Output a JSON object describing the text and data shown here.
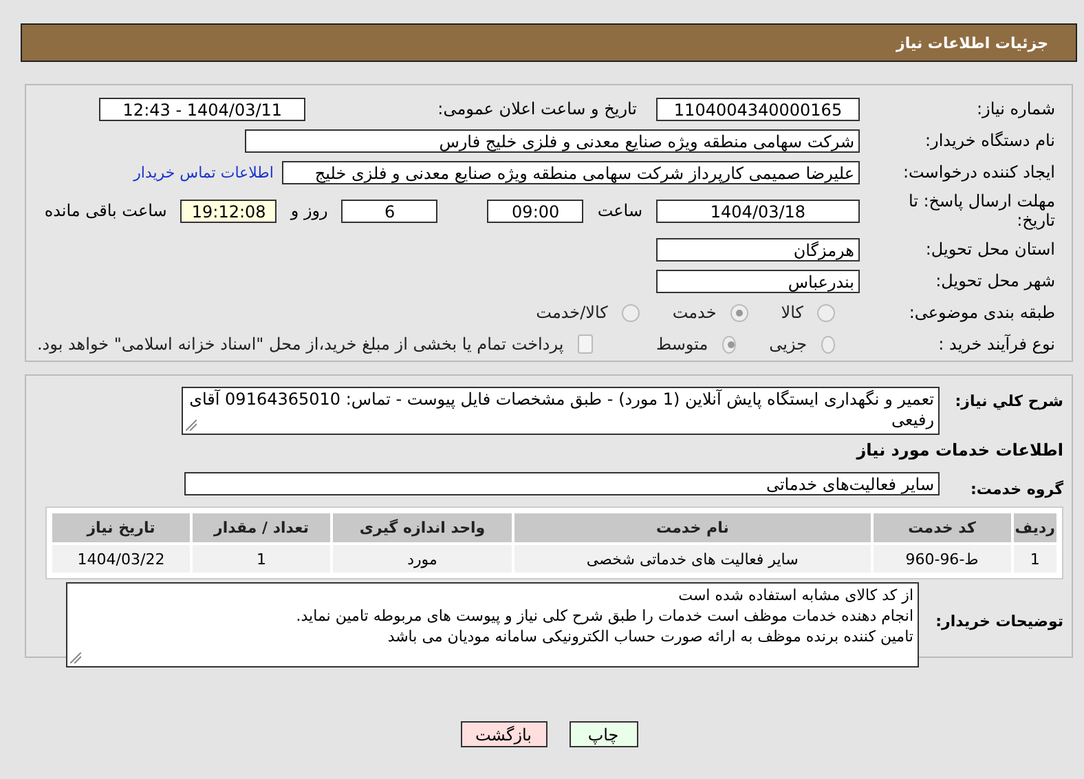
{
  "header": {
    "title": "جزئیات اطلاعات نیاز"
  },
  "details": {
    "need_number": {
      "label": "شماره نیاز:",
      "value": "1104004340000165"
    },
    "announce": {
      "label": "تاریخ و ساعت اعلان عمومی:",
      "value": "1404/03/11 - 12:43"
    },
    "buyer_org": {
      "label": "نام دستگاه خریدار:",
      "value": "شرکت سهامی منطقه ویژه صنایع معدنی و فلزی خلیج فارس"
    },
    "requester": {
      "label": "ایجاد کننده درخواست:",
      "value": "علیرضا صمیمی کارپرداز شرکت سهامی منطقه ویژه صنایع معدنی و فلزی خلیج",
      "link": "اطلاعات تماس خریدار"
    },
    "deadline": {
      "label": "مهلت ارسال پاسخ: تا تاریخ:",
      "date": "1404/03/18",
      "time_label": "ساعت",
      "time": "09:00",
      "days": "6",
      "days_label": "روز و",
      "remaining": "19:12:08",
      "remaining_label": "ساعت باقی مانده"
    },
    "province": {
      "label": "استان محل تحویل:",
      "value": "هرمزگان"
    },
    "city": {
      "label": "شهر محل تحویل:",
      "value": "بندرعباس"
    },
    "category": {
      "label": "طبقه بندی موضوعی:",
      "options": [
        {
          "label": "کالا",
          "selected": false
        },
        {
          "label": "خدمت",
          "selected": true
        },
        {
          "label": "کالا/خدمت",
          "selected": false
        }
      ]
    },
    "process": {
      "label": "نوع فرآیند خرید :",
      "options": [
        {
          "label": "جزیی",
          "selected": false
        },
        {
          "label": "متوسط",
          "selected": true
        }
      ],
      "payment": {
        "checked": false,
        "text": "پرداخت تمام یا بخشی از مبلغ خرید،از محل \"اسناد خزانه اسلامی\" خواهد بود."
      }
    }
  },
  "services": {
    "description": {
      "label": "شرح کلي نياز:",
      "value": "تعمیر و نگهداری ایستگاه پایش آنلاین (1 مورد) - طبق مشخصات فایل پیوست  - تماس: 09164365010 آقای رفیعی"
    },
    "heading": "اطلاعات خدمات مورد نياز",
    "service_group": {
      "label": "گروه خدمت:",
      "value": "سایر فعالیت‌های خدماتی"
    },
    "table": {
      "columns": [
        "ردیف",
        "کد خدمت",
        "نام خدمت",
        "واحد اندازه گیری",
        "تعداد / مقدار",
        "تاریخ نیاز"
      ],
      "rows": [
        [
          "1",
          "ط-96-960",
          "سایر فعالیت های خدماتی شخصی",
          "مورد",
          "1",
          "1404/03/22"
        ]
      ]
    },
    "notes": {
      "label": "توضیحات خریدار:",
      "lines": [
        "از کد کالای مشابه استفاده شده است",
        "انجام دهنده خدمات موظف است خدمات را طبق شرح کلی نیاز و پیوست های مربوطه تامین نماید.",
        "تامین کننده برنده موظف به ارائه صورت حساب الکترونیکی سامانه مودیان می باشد"
      ]
    }
  },
  "buttons": [
    {
      "label": "چاپ",
      "kind": "print"
    },
    {
      "label": "بازگشت",
      "kind": "back"
    }
  ]
}
